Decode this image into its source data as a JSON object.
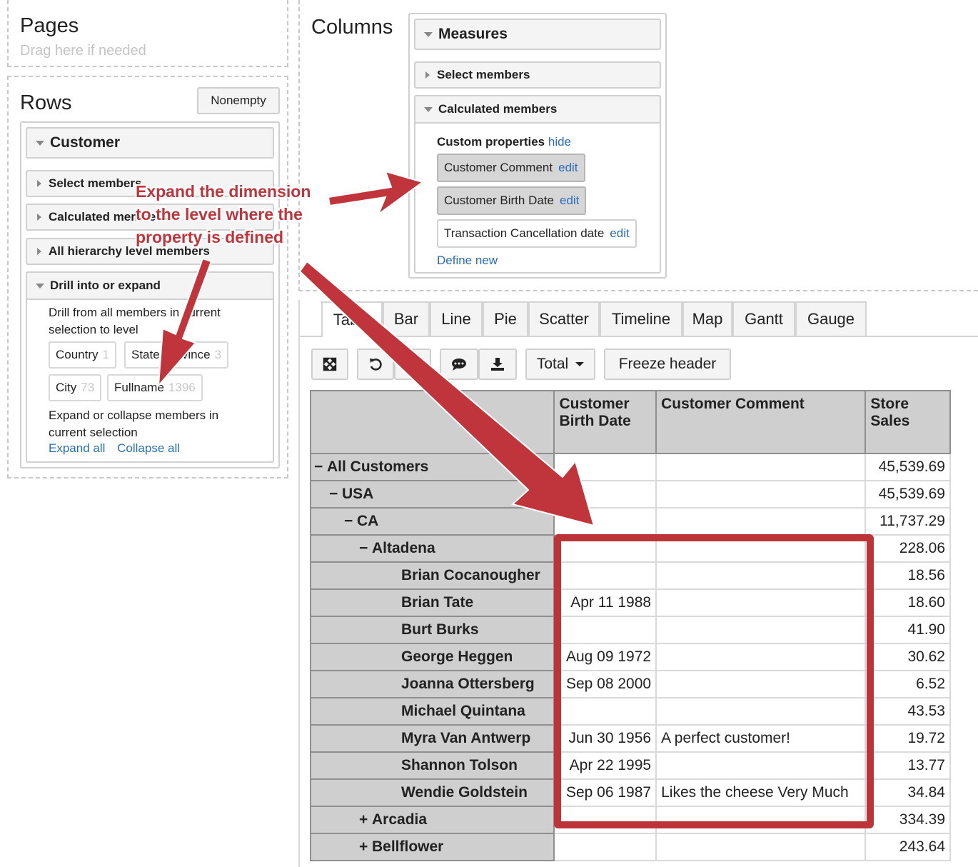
{
  "pages": {
    "title": "Pages",
    "hint": "Drag here if needed"
  },
  "rows": {
    "title": "Rows",
    "nonempty_label": "Nonempty",
    "dimension": "Customer",
    "sections": {
      "select_members": "Select members",
      "calculated_members": "Calculated members",
      "all_levels": "All hierarchy level members",
      "drill": "Drill into or expand"
    },
    "drill_text": "Drill from all members in current selection to level",
    "levels": [
      {
        "name": "Country",
        "count": "1"
      },
      {
        "name": "State Province",
        "count": "3"
      },
      {
        "name": "City",
        "count": "73"
      },
      {
        "name": "Fullname",
        "count": "1396"
      }
    ],
    "expand_text": "Expand or collapse members in current selection",
    "expand_all": "Expand all",
    "collapse_all": "Collapse all"
  },
  "columns": {
    "title": "Columns",
    "dimension": "Measures",
    "select_members": "Select members",
    "calculated_members": "Calculated members",
    "custom_properties_label": "Custom properties",
    "hide_link": "hide",
    "edit_link": "edit",
    "properties": [
      {
        "name": "Customer Comment",
        "selected": true
      },
      {
        "name": "Customer Birth Date",
        "selected": true
      },
      {
        "name": "Transaction Cancellation date",
        "selected": false
      }
    ],
    "define_new": "Define new"
  },
  "tabs": [
    "Table",
    "Bar",
    "Line",
    "Pie",
    "Scatter",
    "Timeline",
    "Map",
    "Gantt",
    "Gauge"
  ],
  "active_tab": "Table",
  "toolbar": {
    "icons": [
      "fullscreen-icon",
      "undo-icon",
      "redo-icon",
      "comment-icon",
      "download-icon"
    ],
    "total_label": "Total",
    "freeze_label": "Freeze header"
  },
  "table": {
    "headers": [
      "Customer Birth Date",
      "Customer Comment",
      "Store Sales"
    ],
    "rows": [
      {
        "label": "All Customers",
        "prefix": "−",
        "indent": 0,
        "birth": "",
        "comment": "",
        "sales": "45,539.69"
      },
      {
        "label": "USA",
        "prefix": "−",
        "indent": 1,
        "birth": "",
        "comment": "",
        "sales": "45,539.69"
      },
      {
        "label": "CA",
        "prefix": "−",
        "indent": 2,
        "birth": "",
        "comment": "",
        "sales": "11,737.29"
      },
      {
        "label": "Altadena",
        "prefix": "−",
        "indent": 3,
        "birth": "",
        "comment": "",
        "sales": "228.06"
      },
      {
        "label": "Brian Cocanougher",
        "prefix": "",
        "indent": 4,
        "birth": "",
        "comment": "",
        "sales": "18.56"
      },
      {
        "label": "Brian Tate",
        "prefix": "",
        "indent": 4,
        "birth": "Apr 11 1988",
        "comment": "",
        "sales": "18.60"
      },
      {
        "label": "Burt Burks",
        "prefix": "",
        "indent": 4,
        "birth": "",
        "comment": "",
        "sales": "41.90"
      },
      {
        "label": "George Heggen",
        "prefix": "",
        "indent": 4,
        "birth": "Aug 09 1972",
        "comment": "",
        "sales": "30.62"
      },
      {
        "label": "Joanna Ottersberg",
        "prefix": "",
        "indent": 4,
        "birth": "Sep 08 2000",
        "comment": "",
        "sales": "6.52"
      },
      {
        "label": "Michael Quintana",
        "prefix": "",
        "indent": 4,
        "birth": "",
        "comment": "",
        "sales": "43.53"
      },
      {
        "label": "Myra Van Antwerp",
        "prefix": "",
        "indent": 4,
        "birth": "Jun 30 1956",
        "comment": "A perfect customer!",
        "sales": "19.72"
      },
      {
        "label": "Shannon Tolson",
        "prefix": "",
        "indent": 4,
        "birth": "Apr 22 1995",
        "comment": "",
        "sales": "13.77"
      },
      {
        "label": "Wendie Goldstein",
        "prefix": "",
        "indent": 4,
        "birth": "Sep 06 1987",
        "comment": "Likes the cheese Very Much",
        "sales": "34.84"
      },
      {
        "label": "Arcadia",
        "prefix": "+",
        "indent": 3,
        "birth": "",
        "comment": "",
        "sales": "334.39"
      },
      {
        "label": "Bellflower",
        "prefix": "+",
        "indent": 3,
        "birth": "",
        "comment": "",
        "sales": "243.64"
      }
    ]
  },
  "annotation": {
    "lines": [
      "Expand the dimension",
      "to the level where the",
      "property is defined"
    ],
    "color": "#c0353b"
  }
}
